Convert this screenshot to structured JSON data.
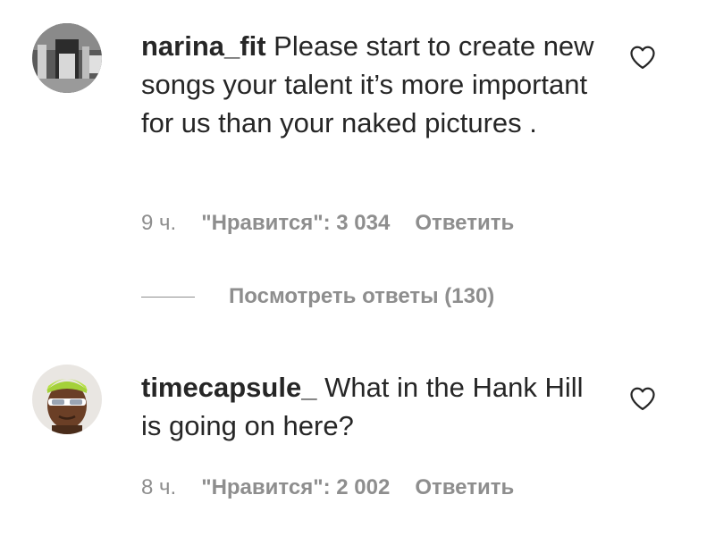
{
  "comments": [
    {
      "username": "narina_fit",
      "text": "Please start to create new songs your talent it’s more important for us than your naked pictures .",
      "time": "9 ч.",
      "likes": "\"Нравится\": 3 034",
      "reply": "Ответить",
      "view_replies": "Посмотреть ответы (130)"
    },
    {
      "username": "timecapsule_",
      "text": "What in the Hank Hill is going on here?",
      "time": "8 ч.",
      "likes": "\"Нравится\": 2 002",
      "reply": "Ответить"
    }
  ],
  "icons": {
    "like": "heart-outline-icon"
  },
  "colors": {
    "text": "#262626",
    "secondary": "#8e8e8e",
    "background": "#ffffff"
  }
}
